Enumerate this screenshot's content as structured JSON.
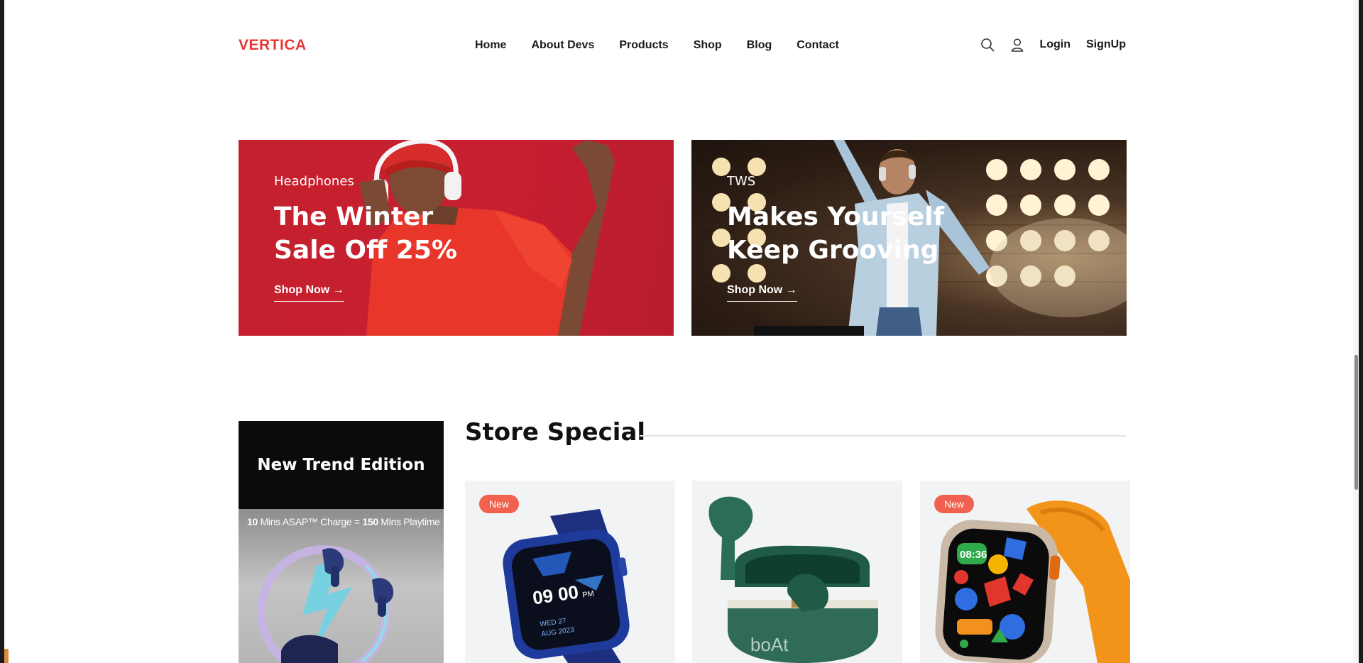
{
  "header": {
    "logo": "VERTICA",
    "nav": [
      "Home",
      "About Devs",
      "Products",
      "Shop",
      "Blog",
      "Contact"
    ],
    "login": "Login",
    "signup": "SignUp",
    "icons": [
      "search-icon",
      "user-icon"
    ]
  },
  "banners": [
    {
      "kicker": "Headphones",
      "title": "The Winter Sale Off 25%",
      "cta": "Shop Now"
    },
    {
      "kicker": "TWS",
      "title": "Makes Yourself Keep Grooving",
      "cta": "Shop Now"
    }
  ],
  "promo": {
    "title": "New Trend Edition",
    "caption_part1": "10",
    "caption_part2": " Mins ASAP™ Charge  =  ",
    "caption_part3": "150",
    "caption_part4": " Mins Playtime"
  },
  "store_special": {
    "title": "Store Special",
    "products": [
      {
        "badge": "New",
        "watch_time": "09 00",
        "watch_ampm": "PM",
        "watch_date": "AUG 2023",
        "watch_day": "WED 27"
      },
      {
        "badge": "",
        "case_brand": "boAt"
      },
      {
        "badge": "New",
        "watch_time": "08:36"
      }
    ]
  },
  "colors": {
    "brand": "#e53935",
    "badge": "#f0624f",
    "red_banner": "#c4202d"
  }
}
